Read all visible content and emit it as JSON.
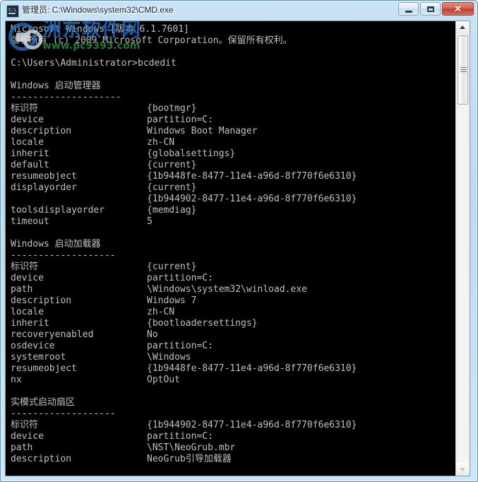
{
  "window": {
    "title": "管理员: C:\\Windows\\system32\\CMD.exe",
    "icon_name": "cmd-icon",
    "icon_glyph": "C:\\",
    "buttons": {
      "minimize": "最小化",
      "maximize": "最大化",
      "close": "✕"
    }
  },
  "watermark": {
    "zh": "洲东软件网",
    "url": "www.pc9393.com"
  },
  "console": {
    "banner": [
      "Microsoft Windows [版本 6.1.7601]",
      "版权所有 (c) 2009 Microsoft Corporation。保留所有权利。"
    ],
    "prompt": "C:\\Users\\Administrator>bcdedit",
    "sections": [
      {
        "heading": "Windows 启动管理器",
        "rule": "--------------------",
        "rows": [
          {
            "key": "标识符",
            "value": "{bootmgr}"
          },
          {
            "key": "device",
            "value": "partition=C:"
          },
          {
            "key": "description",
            "value": "Windows Boot Manager"
          },
          {
            "key": "locale",
            "value": "zh-CN"
          },
          {
            "key": "inherit",
            "value": "{globalsettings}"
          },
          {
            "key": "default",
            "value": "{current}"
          },
          {
            "key": "resumeobject",
            "value": "{1b9448fe-8477-11e4-a96d-8f770f6e6310}"
          },
          {
            "key": "displayorder",
            "value": "{current}"
          },
          {
            "key": "",
            "value": "{1b944902-8477-11e4-a96d-8f770f6e6310}"
          },
          {
            "key": "toolsdisplayorder",
            "value": "{memdiag}"
          },
          {
            "key": "timeout",
            "value": "5"
          }
        ]
      },
      {
        "heading": "Windows 启动加载器",
        "rule": "-------------------",
        "rows": [
          {
            "key": "标识符",
            "value": "{current}"
          },
          {
            "key": "device",
            "value": "partition=C:"
          },
          {
            "key": "path",
            "value": "\\Windows\\system32\\winload.exe"
          },
          {
            "key": "description",
            "value": "Windows 7"
          },
          {
            "key": "locale",
            "value": "zh-CN"
          },
          {
            "key": "inherit",
            "value": "{bootloadersettings}"
          },
          {
            "key": "recoveryenabled",
            "value": "No"
          },
          {
            "key": "osdevice",
            "value": "partition=C:"
          },
          {
            "key": "systemroot",
            "value": "\\Windows"
          },
          {
            "key": "resumeobject",
            "value": "{1b9448fe-8477-11e4-a96d-8f770f6e6310}"
          },
          {
            "key": "nx",
            "value": "OptOut"
          }
        ]
      },
      {
        "heading": "实模式启动扇区",
        "rule": "-------------------",
        "rows": [
          {
            "key": "标识符",
            "value": "{1b944902-8477-11e4-a96d-8f770f6e6310}"
          },
          {
            "key": "device",
            "value": "partition=C:"
          },
          {
            "key": "path",
            "value": "\\NST\\NeoGrub.mbr"
          },
          {
            "key": "description",
            "value": "NeoGrub引导加载器"
          }
        ]
      }
    ]
  },
  "scrollbar": {
    "up_arrow": "scroll-up-arrow-icon",
    "down_arrow": "scroll-down-arrow-icon"
  }
}
